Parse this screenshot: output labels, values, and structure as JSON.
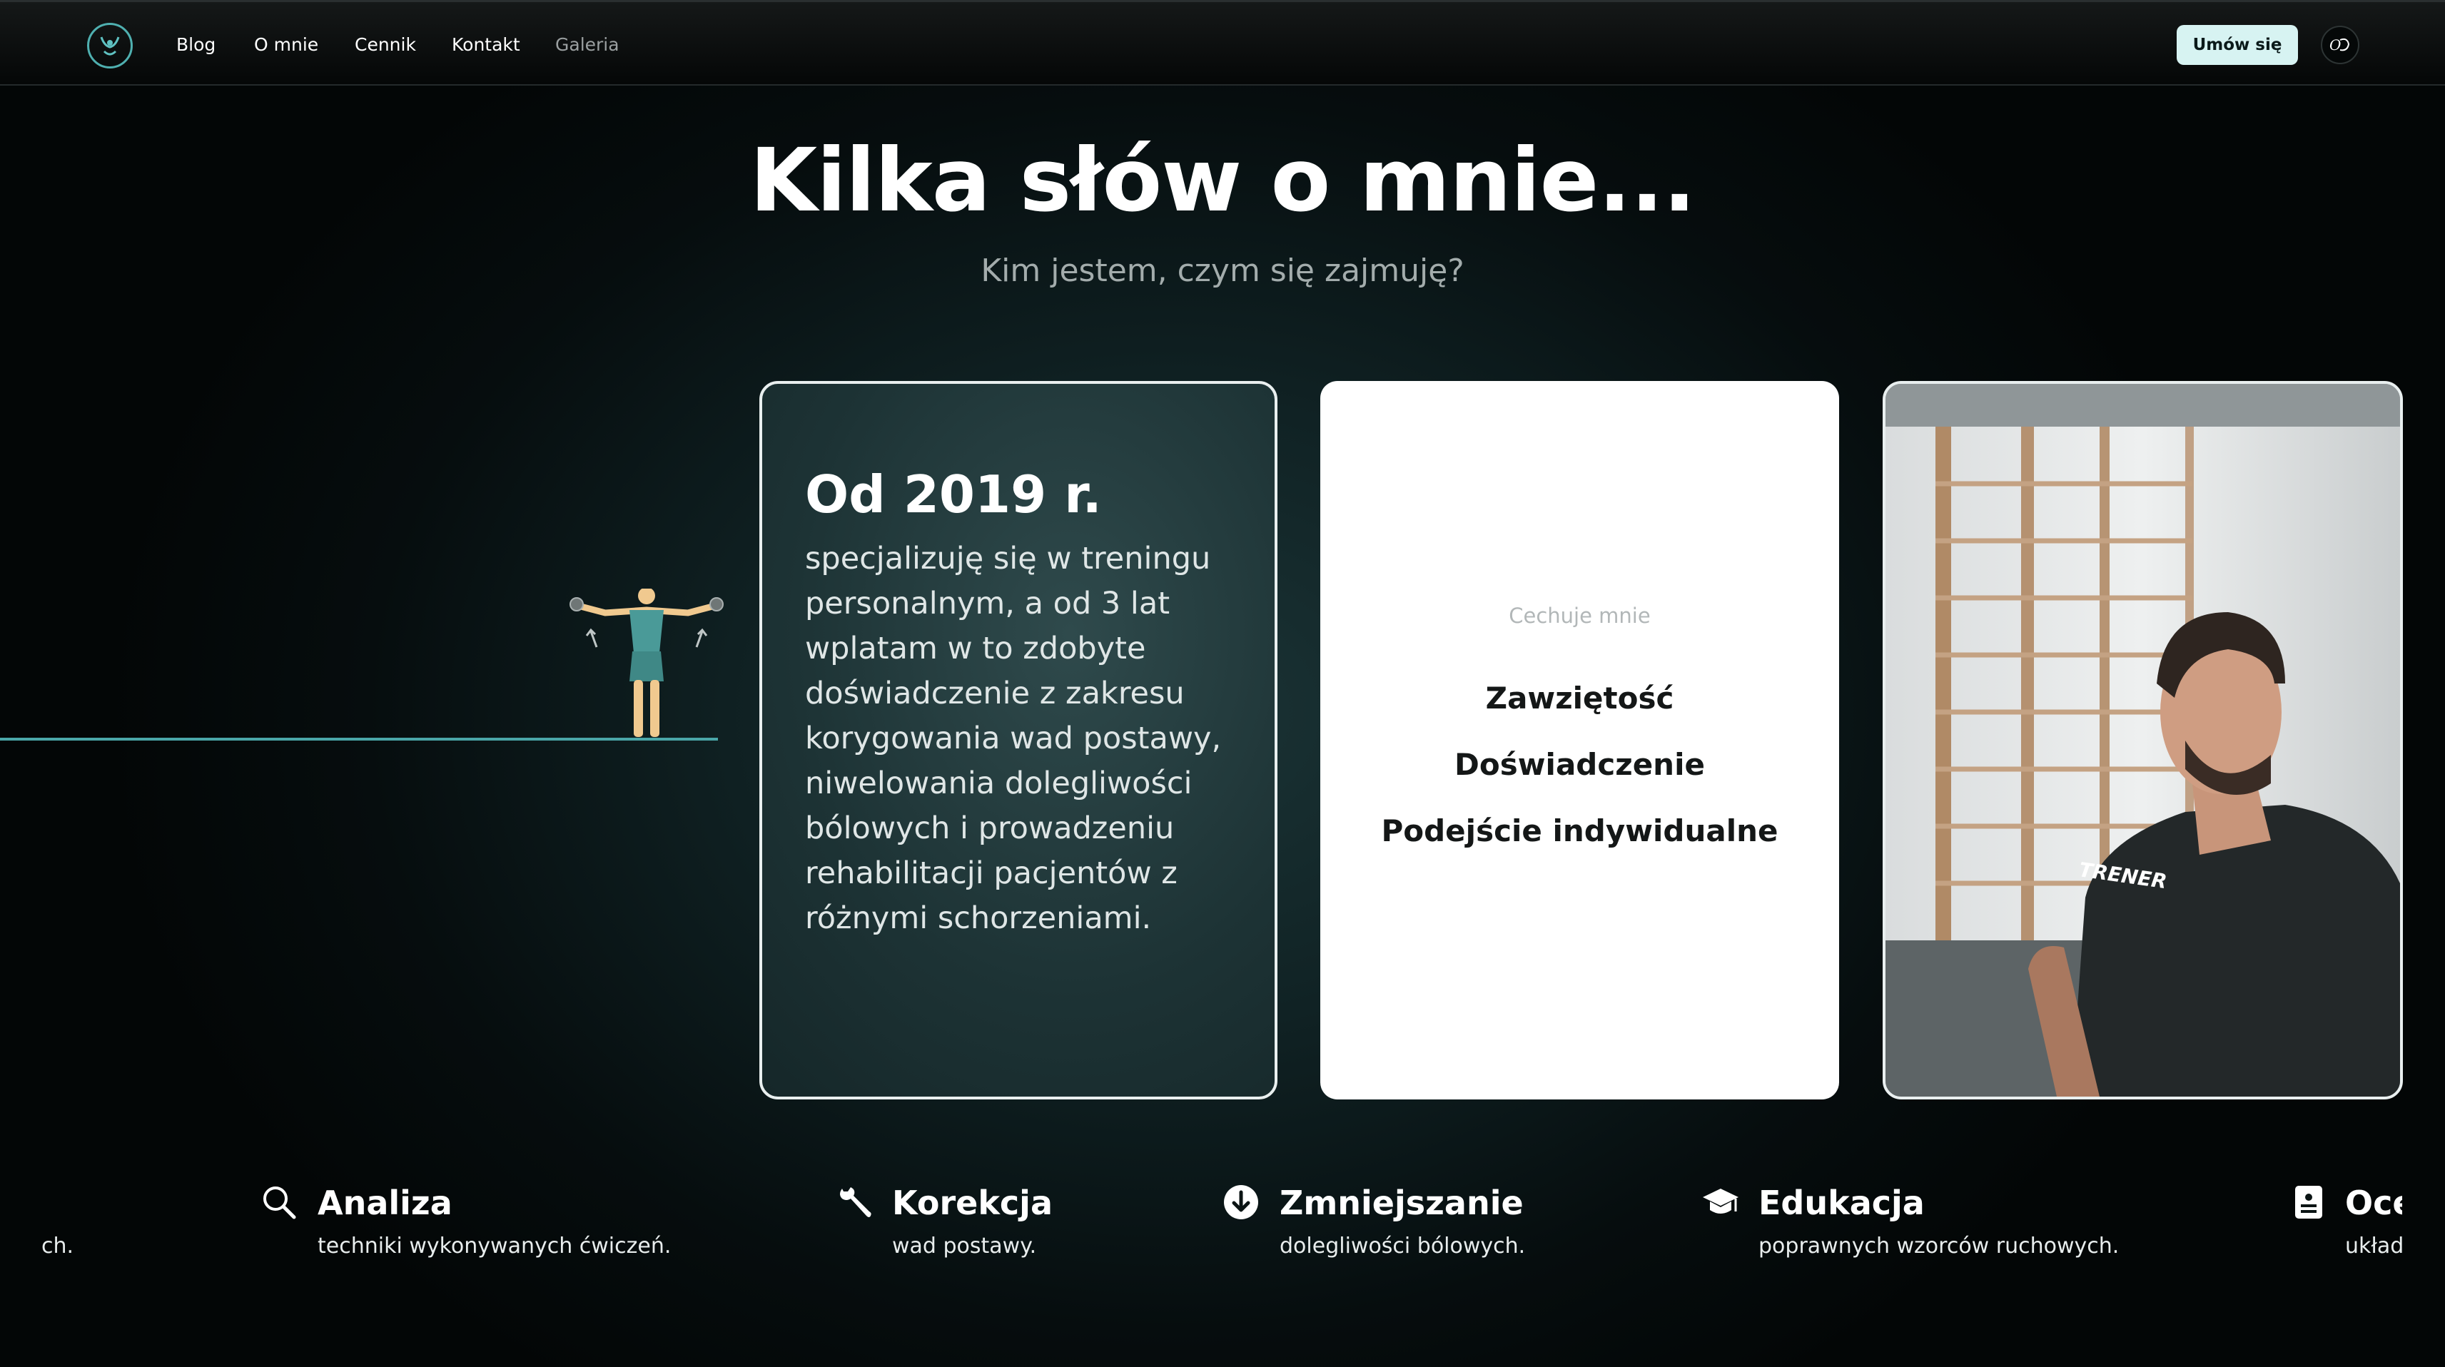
{
  "nav": {
    "links": [
      "Blog",
      "O mnie",
      "Cennik",
      "Kontakt",
      "Galeria"
    ],
    "cta": "Umów się",
    "accent": "#4fb0b0",
    "cta_bg": "#d7f3f2"
  },
  "hero": {
    "title": "Kilka słów o mnie...",
    "subtitle": "Kim jestem, czym się zajmuję?"
  },
  "card_dark": {
    "heading": "Od 2019 r.",
    "text": "specjalizuję się w treningu personalnym, a od 3 lat wplatam w to zdobyte doświadczenie z zakresu korygowania wad postawy, niwelowania dolegliwości bólowych i prowadzeniu rehabilitacji pacjentów z różnymi schorzeniami."
  },
  "card_white": {
    "label": "Cechuje mnie",
    "traits": [
      "Zawziętość",
      "Doświadczenie",
      "Podejście indywidualne"
    ]
  },
  "card_photo": {
    "shirt_text": "TRENER"
  },
  "features": [
    {
      "icon": "search-icon",
      "title": "Analiza",
      "desc": "techniki wykonywanych ćwiczeń."
    },
    {
      "icon": "wrench-icon",
      "title": "Korekcja",
      "desc": "wad postawy."
    },
    {
      "icon": "arrow-down-circle-icon",
      "title": "Zmniejszanie",
      "desc": "dolegliwości bólowych."
    },
    {
      "icon": "graduation-cap-icon",
      "title": "Edukacja",
      "desc": "poprawnych wzorców ruchowych."
    },
    {
      "icon": "document-icon",
      "title": "Oce",
      "desc": "układ"
    }
  ],
  "feature_left_fragment": "ch."
}
